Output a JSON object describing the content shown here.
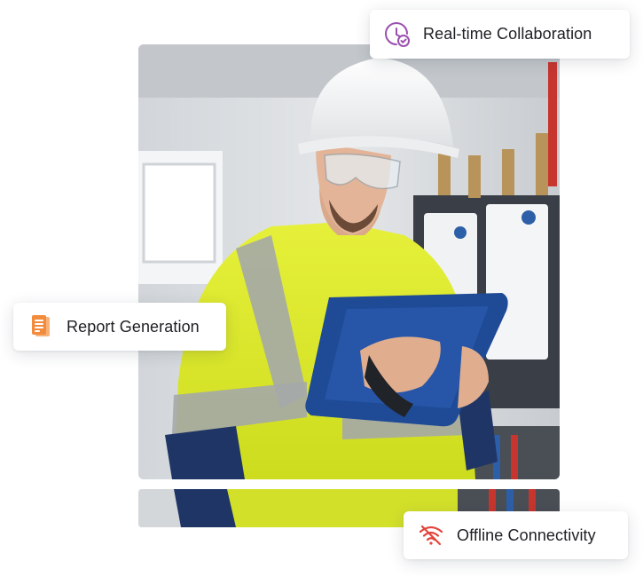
{
  "features": {
    "realtime": {
      "label": "Real-time Collaboration",
      "icon": "clock-check-icon",
      "color": "#9b4fb0"
    },
    "report": {
      "label": "Report Generation",
      "icon": "document-icon",
      "color": "#f28b3b"
    },
    "offline": {
      "label": "Offline Connectivity",
      "icon": "wifi-off-icon",
      "color": "#e2453b"
    }
  },
  "photo": {
    "subject": "worker-with-tablet"
  }
}
